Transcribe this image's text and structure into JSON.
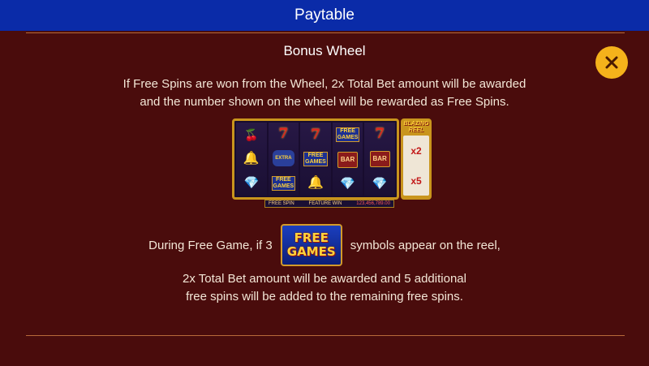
{
  "header": {
    "title": "Paytable"
  },
  "close_button": {
    "icon": "close-icon"
  },
  "section": {
    "heading": "Bonus Wheel",
    "para1_line1": "If Free Spins are won from the Wheel, 2x Total Bet amount will be awarded",
    "para1_line2": "and the number shown on the wheel will be rewarded as Free Spins.",
    "row2_before": "During Free Game, if 3",
    "row2_after": "symbols appear on the reel,",
    "para3_line1": "2x Total Bet amount will be awarded and 5 additional",
    "para3_line2": "free spins will be added to the remaining free spins."
  },
  "free_games_symbol": {
    "line1": "FREE",
    "line2": "GAMES"
  },
  "machine": {
    "reel_symbols": {
      "cherry": "🍒",
      "seven": "7",
      "bell": "🔔",
      "gem": "💎",
      "bar": "BAR",
      "extra": "EXTRA",
      "fg_line1": "FREE",
      "fg_line2": "GAMES"
    },
    "bonus_reel_logo_line1": "BLAZING",
    "bonus_reel_logo_line2": "REEL",
    "bonus_multipliers": [
      "x2",
      "x5"
    ],
    "status_free_spin": "FREE SPIN",
    "status_feature_win": "FEATURE WIN",
    "status_value": "123,456,789.00"
  },
  "colors": {
    "background": "#4a0c0c",
    "header_bar": "#0a2ba8",
    "close_button": "#f5b21b",
    "divider": "#b86a3a"
  }
}
